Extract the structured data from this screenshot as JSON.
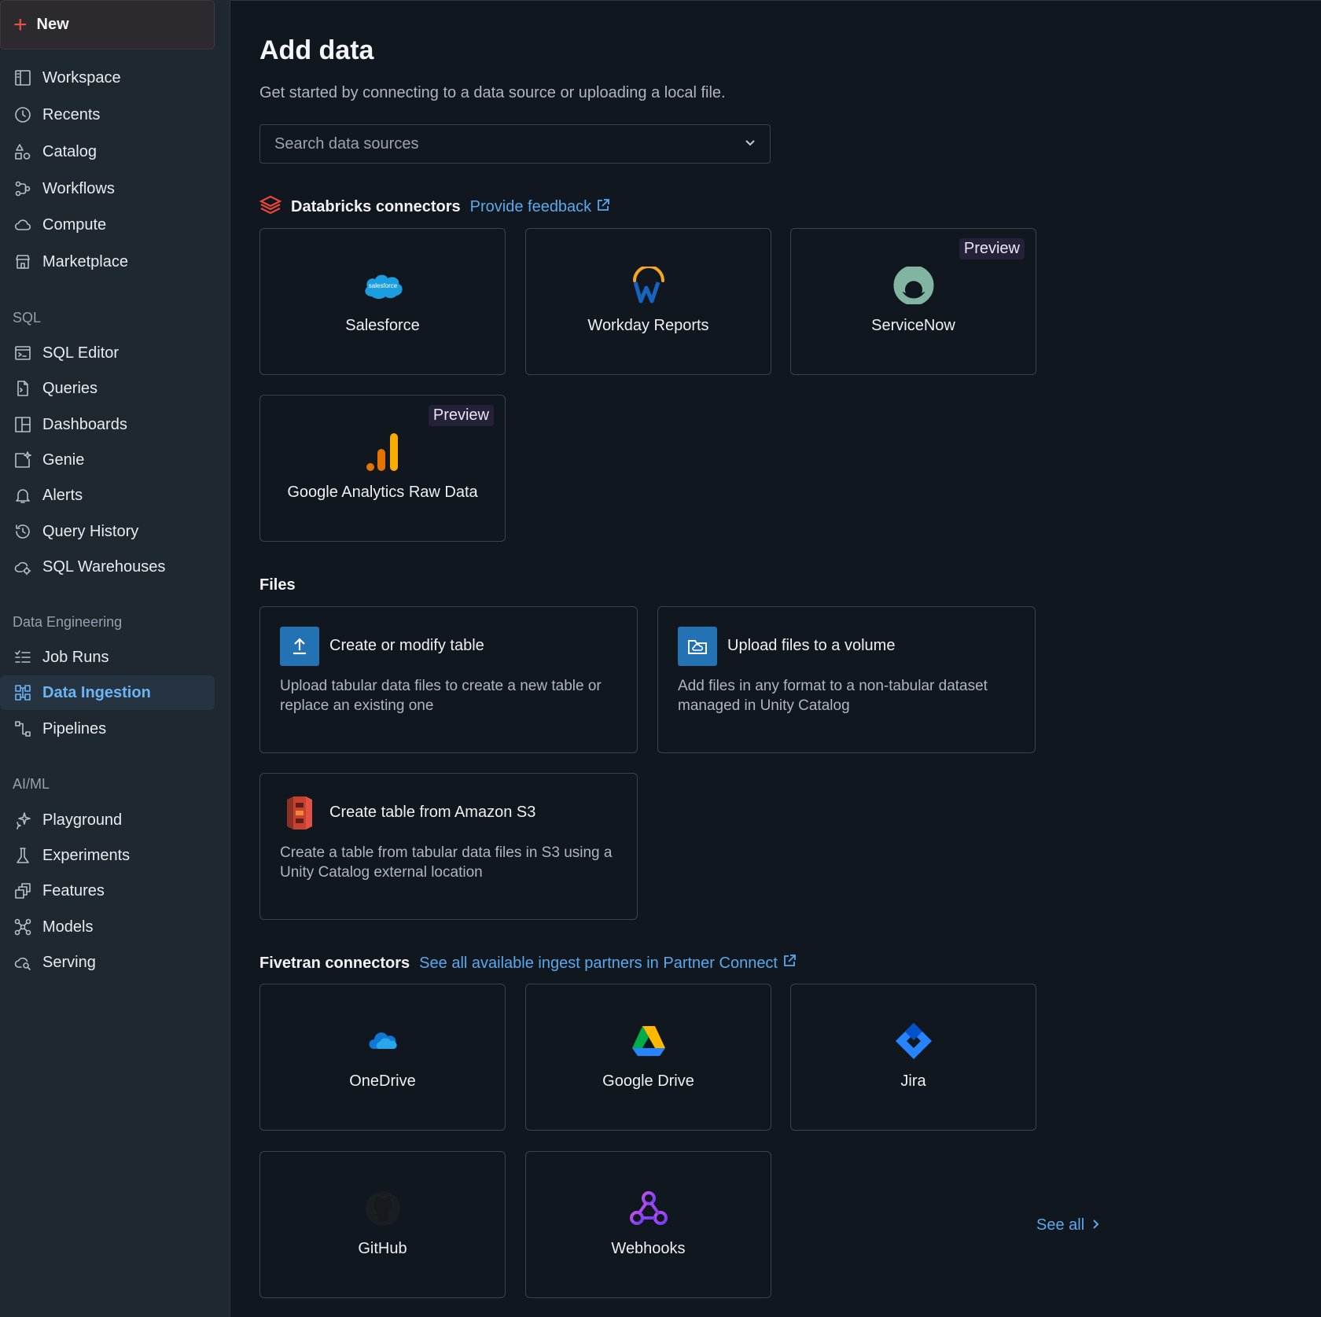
{
  "sidebar": {
    "new_label": "New",
    "items_top": [
      {
        "label": "Workspace"
      },
      {
        "label": "Recents"
      },
      {
        "label": "Catalog"
      },
      {
        "label": "Workflows"
      },
      {
        "label": "Compute"
      },
      {
        "label": "Marketplace"
      }
    ],
    "sql_section": "SQL",
    "items_sql": [
      {
        "label": "SQL Editor"
      },
      {
        "label": "Queries"
      },
      {
        "label": "Dashboards"
      },
      {
        "label": "Genie"
      },
      {
        "label": "Alerts"
      },
      {
        "label": "Query History"
      },
      {
        "label": "SQL Warehouses"
      }
    ],
    "de_section": "Data Engineering",
    "items_de": [
      {
        "label": "Job Runs"
      },
      {
        "label": "Data Ingestion"
      },
      {
        "label": "Pipelines"
      }
    ],
    "ml_section": "AI/ML",
    "items_ml": [
      {
        "label": "Playground"
      },
      {
        "label": "Experiments"
      },
      {
        "label": "Features"
      },
      {
        "label": "Models"
      },
      {
        "label": "Serving"
      }
    ]
  },
  "main": {
    "title": "Add data",
    "subtitle": "Get started by connecting to a data source or uploading a local file.",
    "search_placeholder": "Search data sources",
    "databricks": {
      "title": "Databricks connectors",
      "link": "Provide feedback",
      "tiles": [
        {
          "name": "Salesforce",
          "logo_text": "salesforce"
        },
        {
          "name": "Workday Reports"
        },
        {
          "name": "ServiceNow",
          "badge": "Preview"
        },
        {
          "name": "Google Analytics Raw Data",
          "badge": "Preview"
        }
      ]
    },
    "files": {
      "title": "Files",
      "tiles": [
        {
          "title": "Create or modify table",
          "desc": "Upload tabular data files to create a new table or replace an existing one"
        },
        {
          "title": "Upload files to a volume",
          "desc": "Add files in any format to a non-tabular dataset managed in Unity Catalog"
        },
        {
          "title": "Create table from Amazon S3",
          "desc": "Create a table from tabular data files in S3 using a Unity Catalog external location"
        }
      ]
    },
    "fivetran": {
      "title": "Fivetran connectors",
      "link": "See all available ingest partners in Partner Connect",
      "tiles": [
        {
          "name": "OneDrive"
        },
        {
          "name": "Google Drive"
        },
        {
          "name": "Jira"
        },
        {
          "name": "GitHub"
        },
        {
          "name": "Webhooks"
        }
      ],
      "see_all": "See all"
    }
  },
  "colors": {
    "background": "#11171e",
    "sidebar": "#1f272f",
    "accent_link": "#5aa8ee",
    "active_nav": "#6cb4f5",
    "new_plus": "#e5534b"
  }
}
